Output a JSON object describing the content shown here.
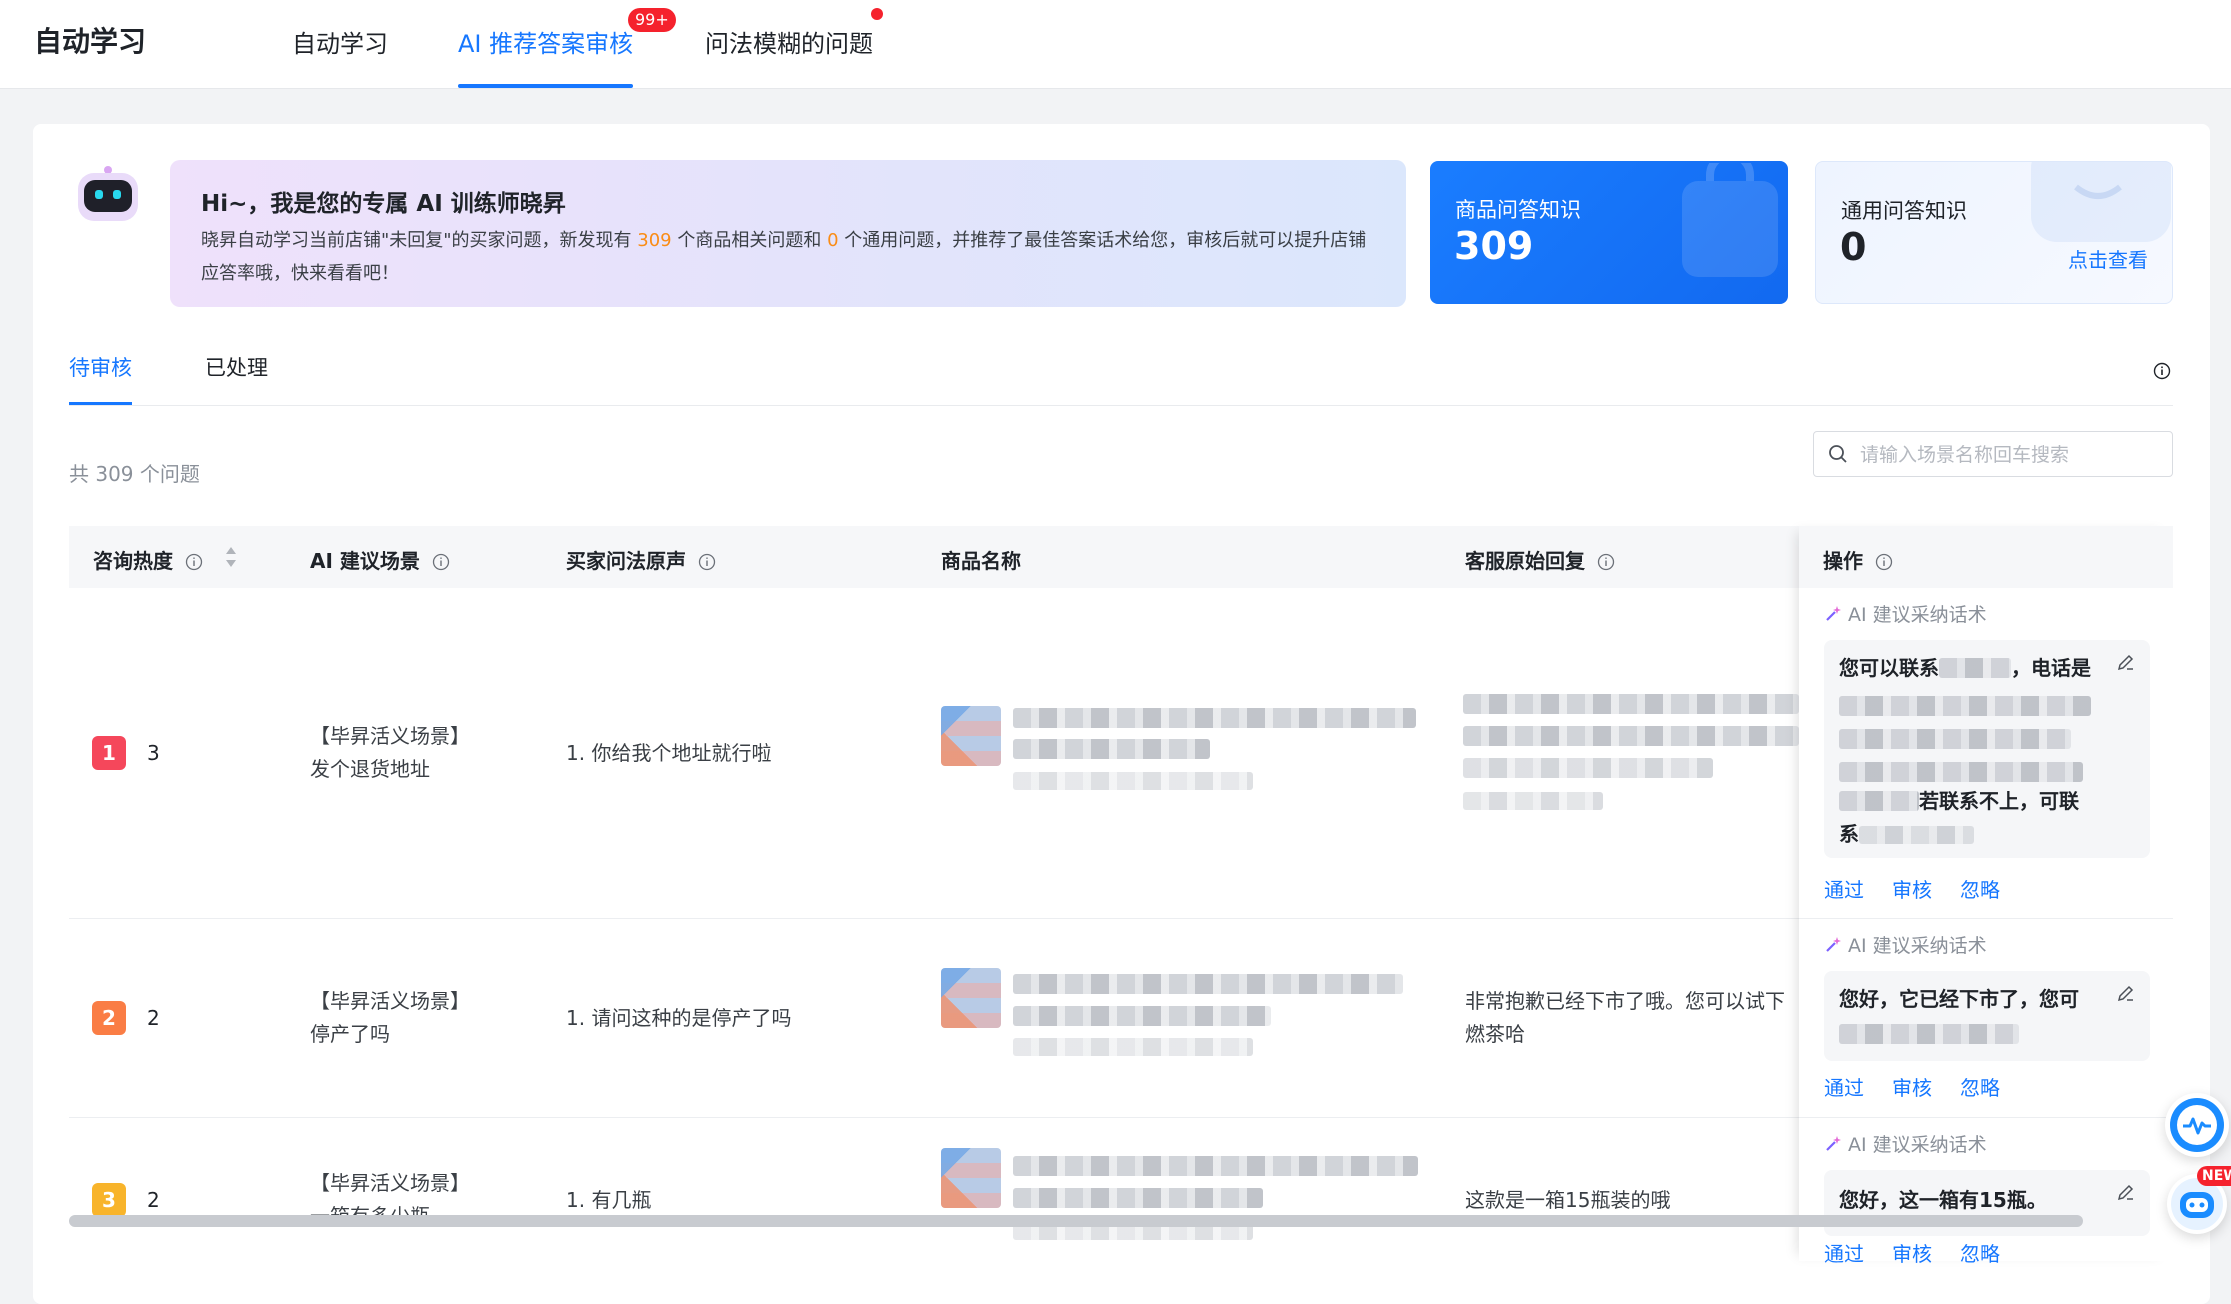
{
  "app_title": "自动学习",
  "nav": {
    "tabs": [
      {
        "label": "自动学习"
      },
      {
        "label": "AI 推荐答案审核"
      },
      {
        "label": "问法模糊的问题"
      }
    ],
    "badge": "99+"
  },
  "hero": {
    "title": "Hi~，我是您的专属 AI 训练师晓昇",
    "desc_1": "晓昇自动学习当前店铺\"未回复\"的买家问题，新发现有 ",
    "count_product": "309",
    "desc_2": " 个商品相关问题和 ",
    "count_general": "0",
    "desc_3": " 个通用问题，并推荐了最佳答案话术给您，审核后就可以提升店铺应答率哦，快来看看吧！"
  },
  "stats": {
    "product": {
      "label": "商品问答知识",
      "value": "309"
    },
    "general": {
      "label": "通用问答知识",
      "value": "0",
      "link": "点击查看"
    }
  },
  "sub_tabs": [
    {
      "label": "待审核"
    },
    {
      "label": "已处理"
    }
  ],
  "total_text": "共 309 个问题",
  "search": {
    "placeholder": "请输入场景名称回车搜索"
  },
  "table": {
    "columns": [
      "咨询热度",
      "AI 建议场景",
      "买家问法原声",
      "商品名称",
      "客服原始回复",
      "操作"
    ],
    "rows": [
      {
        "rank": "1",
        "heat": "3",
        "scene_1": "【毕昇活义场景】",
        "scene_2": "发个退货地址",
        "question": "1. 你给我个地址就行啦",
        "reply_1": "",
        "reply_2": "",
        "ai_tag": "AI 建议采纳话术",
        "suggest_1": "您可以联系",
        "suggest_2": "，电话是",
        "suggest_3": "若联系不上，可联",
        "suggest_4": "系"
      },
      {
        "rank": "2",
        "heat": "2",
        "scene_1": "【毕昇活义场景】",
        "scene_2": "停产了吗",
        "question": "1. 请问这种的是停产了吗",
        "reply_1": "非常抱歉已经下市了哦。您可以试下",
        "reply_2": "燃茶哈",
        "ai_tag": "AI 建议采纳话术",
        "suggest_1": "您好，它已经下市了，您可"
      },
      {
        "rank": "3",
        "heat": "2",
        "scene_1": "【毕昇活义场景】",
        "scene_2": "一箱有多少瓶",
        "question": "1. 有几瓶",
        "reply_1": "这款是一箱15瓶装的哦",
        "ai_tag": "AI 建议采纳话术",
        "suggest_1": "您好，这一箱有15瓶。"
      }
    ],
    "actions": {
      "approve": "通过",
      "review": "审核",
      "ignore": "忽略"
    }
  },
  "float": {
    "new_badge": "NEW"
  },
  "colors": {
    "accent": "#1677ff",
    "rank1": "#f5475b",
    "rank2": "#fa7d45",
    "rank3": "#f8b42b"
  }
}
